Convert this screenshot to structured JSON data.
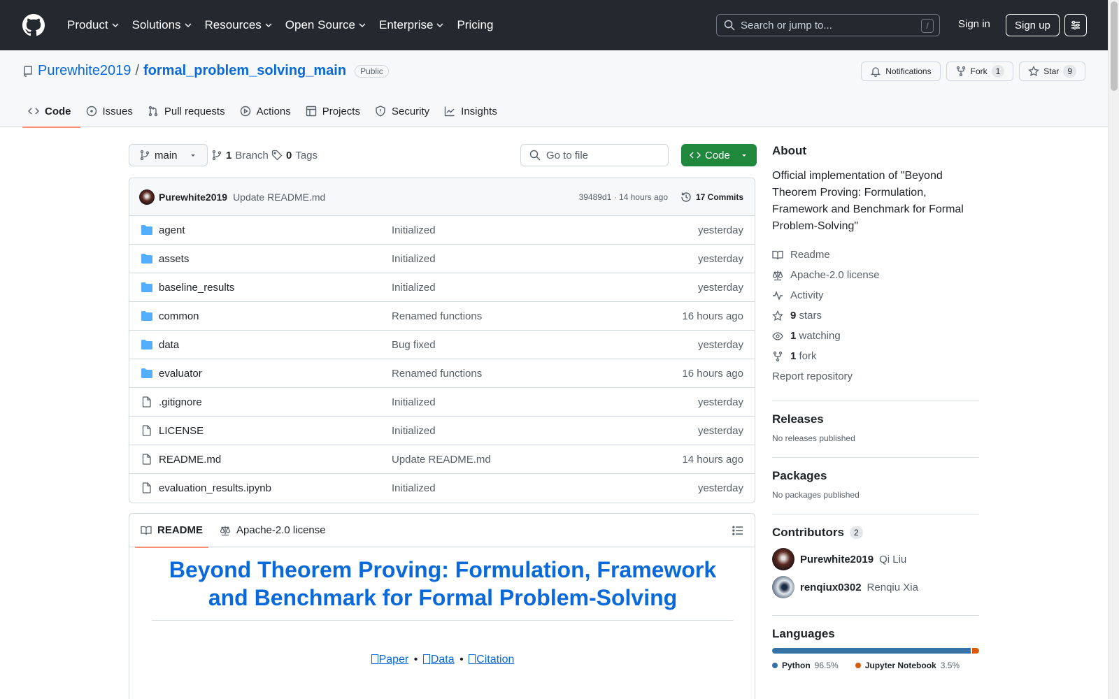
{
  "topnav": {
    "items": [
      "Product",
      "Solutions",
      "Resources",
      "Open Source",
      "Enterprise",
      "Pricing"
    ],
    "search_placeholder": "Search or jump to...",
    "search_shortcut": "/",
    "signin": "Sign in",
    "signup": "Sign up"
  },
  "repo": {
    "owner": "Purewhite2019",
    "separator": "/",
    "name": "formal_problem_solving_main",
    "visibility": "Public",
    "notifications_label": "Notifications",
    "fork_label": "Fork",
    "fork_count": "1",
    "star_label": "Star",
    "star_count": "9"
  },
  "tabs": [
    "Code",
    "Issues",
    "Pull requests",
    "Actions",
    "Projects",
    "Security",
    "Insights"
  ],
  "branchbar": {
    "branch": "main",
    "branch_count": "1",
    "branch_label": "Branch",
    "tag_count": "0",
    "tag_label": "Tags",
    "goto_placeholder": "Go to file",
    "code_label": "Code"
  },
  "commit": {
    "author": "Purewhite2019",
    "message": "Update README.md",
    "hash_time": "39489d1 · 14 hours ago",
    "commits": "17 Commits"
  },
  "files": [
    {
      "name": "agent",
      "type": "dir",
      "message": "Initialized",
      "date": "yesterday"
    },
    {
      "name": "assets",
      "type": "dir",
      "message": "Initialized",
      "date": "yesterday"
    },
    {
      "name": "baseline_results",
      "type": "dir",
      "message": "Initialized",
      "date": "yesterday"
    },
    {
      "name": "common",
      "type": "dir",
      "message": "Renamed functions",
      "date": "16 hours ago"
    },
    {
      "name": "data",
      "type": "dir",
      "message": "Bug fixed",
      "date": "yesterday"
    },
    {
      "name": "evaluator",
      "type": "dir",
      "message": "Renamed functions",
      "date": "16 hours ago"
    },
    {
      "name": ".gitignore",
      "type": "file",
      "message": "Initialized",
      "date": "yesterday"
    },
    {
      "name": "LICENSE",
      "type": "file",
      "message": "Initialized",
      "date": "yesterday"
    },
    {
      "name": "README.md",
      "type": "file",
      "message": "Update README.md",
      "date": "14 hours ago"
    },
    {
      "name": "evaluation_results.ipynb",
      "type": "file",
      "message": "Initialized",
      "date": "yesterday"
    }
  ],
  "readme": {
    "tab_readme": "README",
    "tab_license": "Apache-2.0 license",
    "title": "Beyond Theorem Proving: Formulation, Framework and Benchmark for Formal Problem-Solving",
    "links": [
      "Paper",
      "Data",
      "Citation"
    ],
    "link_separator": "•"
  },
  "about": {
    "heading": "About",
    "description": "Official implementation of \"Beyond Theorem Proving: Formulation, Framework and Benchmark for Formal Problem-Solving\"",
    "readme": "Readme",
    "license": "Apache-2.0 license",
    "activity": "Activity",
    "stars_count": "9",
    "stars_label": "stars",
    "watching_count": "1",
    "watching_label": "watching",
    "forks_count": "1",
    "forks_label": "fork",
    "report": "Report repository"
  },
  "releases": {
    "heading": "Releases",
    "empty": "No releases published"
  },
  "packages": {
    "heading": "Packages",
    "empty": "No packages published"
  },
  "contributors": {
    "heading": "Contributors",
    "count": "2",
    "list": [
      {
        "login": "Purewhite2019",
        "name": "Qi Liu"
      },
      {
        "login": "renqiux0302",
        "name": "Renqiu Xia"
      }
    ]
  },
  "languages": {
    "heading": "Languages",
    "list": [
      {
        "name": "Python",
        "percent": "96.5%",
        "value": 96.5,
        "color": "#3572A5"
      },
      {
        "name": "Jupyter Notebook",
        "percent": "3.5%",
        "value": 3.5,
        "color": "#DA5B0B"
      }
    ]
  },
  "colors": {
    "accent": "#0969da",
    "header_bg": "#24292f",
    "primary_button": "#1f883d",
    "tab_underline": "#fd8c73"
  }
}
